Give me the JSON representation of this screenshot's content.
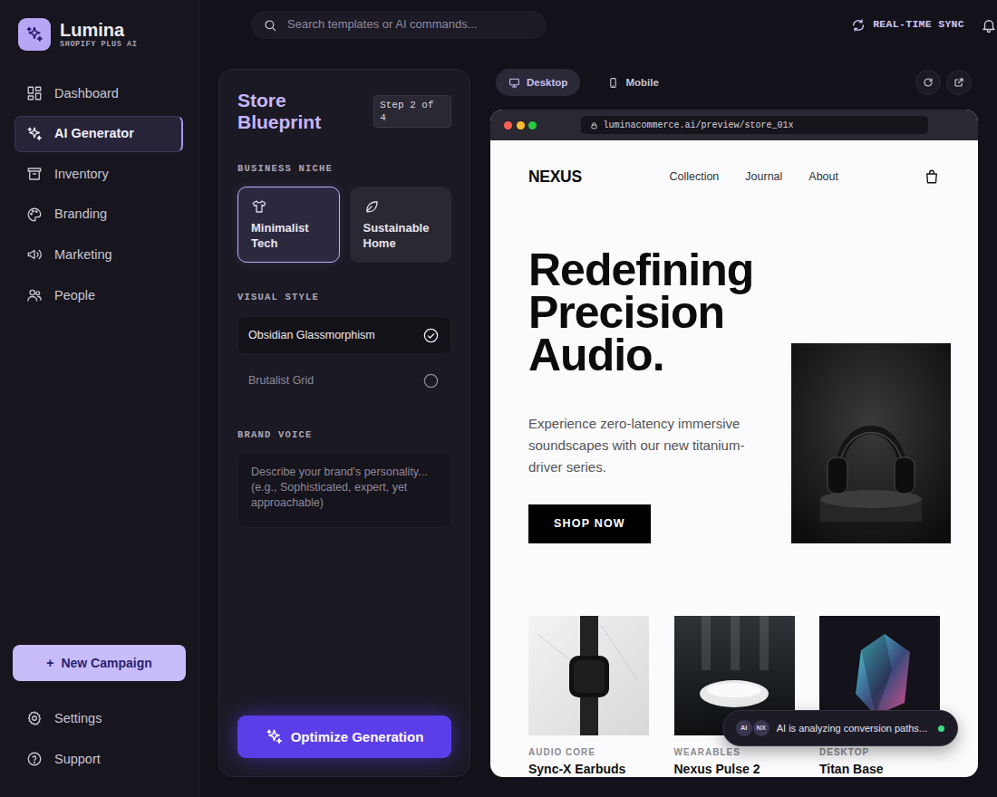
{
  "app": {
    "name": "Lumina",
    "tagline": "SHOPIFY PLUS AI"
  },
  "search": {
    "placeholder": "Search templates or AI commands..."
  },
  "sync": {
    "label": "REAL-TIME SYNC"
  },
  "sidebar": {
    "items": [
      {
        "label": "Dashboard",
        "selected": false
      },
      {
        "label": "AI Generator",
        "selected": true
      },
      {
        "label": "Inventory",
        "selected": false
      },
      {
        "label": "Branding",
        "selected": false
      },
      {
        "label": "Marketing",
        "selected": false
      },
      {
        "label": "People",
        "selected": false
      }
    ],
    "new_campaign": {
      "icon": "+",
      "label": "New Campaign"
    },
    "footer": [
      {
        "label": "Settings"
      },
      {
        "label": "Support"
      }
    ]
  },
  "blueprint": {
    "title": "Store Blueprint",
    "step": "Step 2 of 4",
    "niche_label": "BUSINESS NICHE",
    "niches": [
      {
        "label": "Minimalist Tech",
        "selected": true
      },
      {
        "label": "Sustainable Home",
        "selected": false
      }
    ],
    "style_label": "VISUAL STYLE",
    "styles": [
      {
        "label": "Obsidian Glassmorphism",
        "selected": true
      },
      {
        "label": "Brutalist Grid",
        "selected": false
      }
    ],
    "voice_label": "BRAND VOICE",
    "voice_placeholder": "Describe your brand's personality...\n(e.g., Sophisticated, expert, yet approachable)",
    "optimize_button": "Optimize Generation"
  },
  "preview": {
    "views": [
      {
        "label": "Desktop",
        "selected": true
      },
      {
        "label": "Mobile",
        "selected": false
      }
    ],
    "url": "luminacommerce.ai/preview/store_01x",
    "store": {
      "brand": "NEXUS",
      "nav": [
        "Collection",
        "Journal",
        "About"
      ],
      "headline": "Redefining Precision Audio.",
      "subhead": "Experience zero-latency immersive soundscapes with our new titanium-driver series.",
      "cta": "SHOP NOW",
      "products": [
        {
          "category": "AUDIO CORE",
          "name": "Sync-X Earbuds"
        },
        {
          "category": "WEARABLES",
          "name": "Nexus Pulse 2"
        },
        {
          "category": "DESKTOP",
          "name": "Titan Base"
        }
      ]
    }
  },
  "toast": {
    "avatars": [
      "AI",
      "NX"
    ],
    "text": "AI is analyzing conversion paths...",
    "live": true
  }
}
